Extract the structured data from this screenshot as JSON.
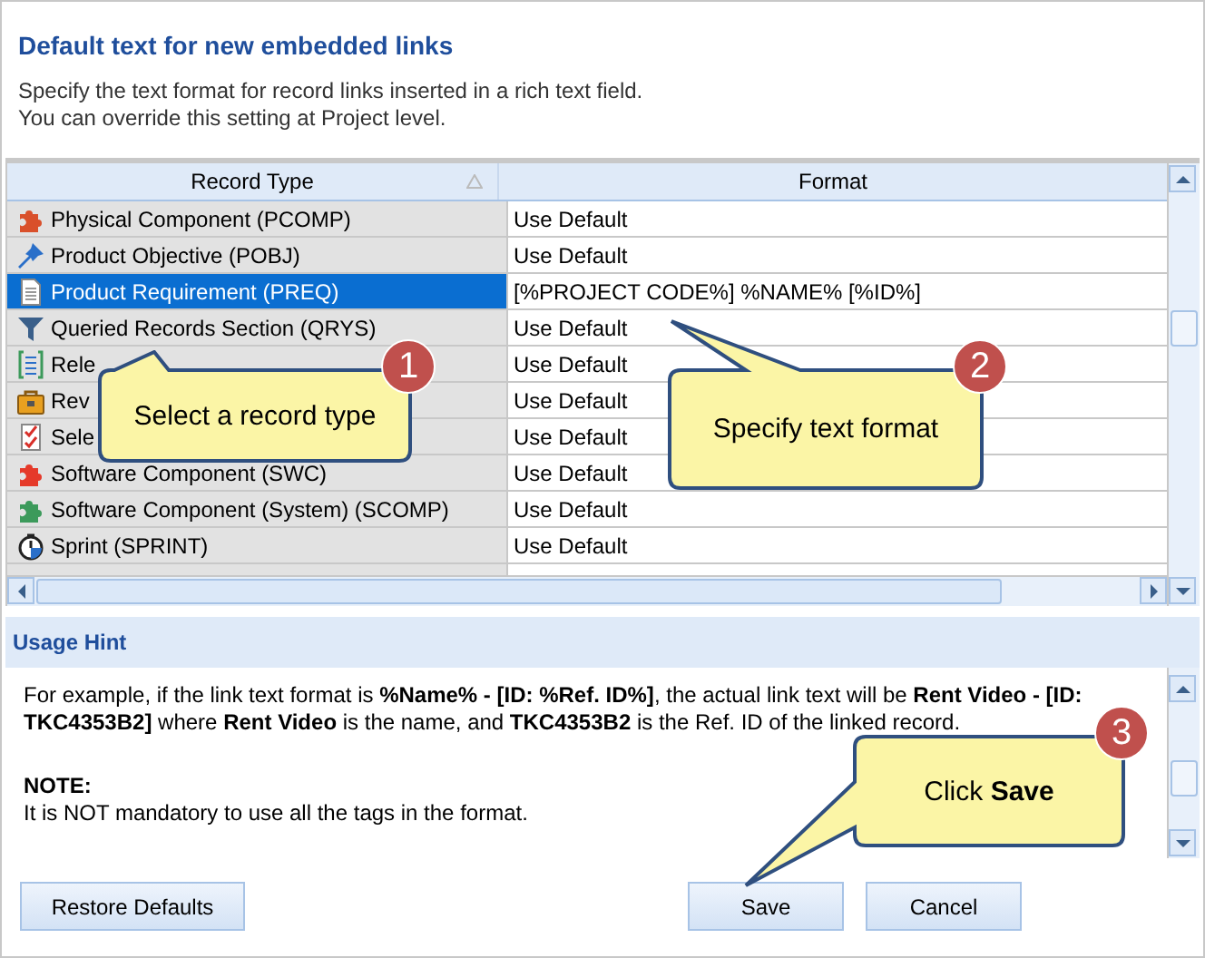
{
  "header": {
    "title": "Default text for new embedded links",
    "description": [
      "Specify the text format for record links inserted in a rich text field.",
      "You can override this setting at Project level."
    ]
  },
  "table": {
    "columns": [
      "Record Type",
      "Format"
    ],
    "rows": [
      {
        "record_type": "Physical Component (PCOMP)",
        "format": "Use Default",
        "selected": false
      },
      {
        "record_type": "Product Objective (POBJ)",
        "format": "Use Default",
        "selected": false
      },
      {
        "record_type": "Product Requirement (PREQ)",
        "format": "[%PROJECT CODE%] %NAME% [%ID%]",
        "selected": true
      },
      {
        "record_type": "Queried Records Section (QRYS)",
        "format": "Use Default",
        "selected": false
      },
      {
        "record_type": "Rele",
        "format": "Use Default",
        "selected": false
      },
      {
        "record_type": "Rev",
        "format": "Use Default",
        "selected": false
      },
      {
        "record_type": "Sele",
        "format": "Use Default",
        "selected": false
      },
      {
        "record_type": "Software Component (SWC)",
        "format": "Use Default",
        "selected": false
      },
      {
        "record_type": "Software Component (System) (SCOMP)",
        "format": "Use Default",
        "selected": false
      },
      {
        "record_type": "Sprint (SPRINT)",
        "format": "Use Default",
        "selected": false
      }
    ]
  },
  "usage_hint": {
    "title": "Usage Hint",
    "text": "For example, if the link text format is **%Name% - [ID: %Ref. ID%]**, the actual link text will be **Rent Video - [ID: TKC4353B2]** where **Rent Video** is the name, and **TKC4353B2** is the Ref. ID of the linked record.",
    "note_title": "NOTE:",
    "note": "It is NOT mandatory to use all the tags in the format."
  },
  "buttons": [
    {
      "label": "Restore Defaults",
      "kind": "left"
    },
    {
      "label": "Save",
      "kind": "right"
    },
    {
      "label": "Cancel",
      "kind": "right"
    }
  ],
  "callouts": [
    {
      "number": "1",
      "text": "Select a record type"
    },
    {
      "number": "2",
      "text": "Specify text format"
    },
    {
      "number": "3",
      "text": "Click **Save**"
    }
  ]
}
